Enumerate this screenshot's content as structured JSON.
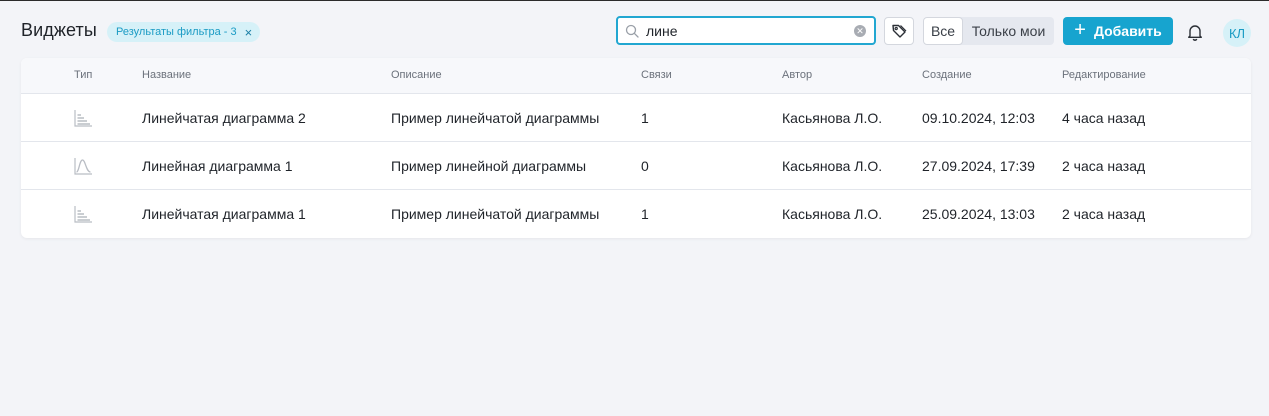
{
  "header": {
    "title": "Виджеты",
    "filter_chip": {
      "label": "Результаты фильтра - 3",
      "close": "×"
    },
    "search": {
      "value": "лине",
      "placeholder": ""
    },
    "segment": {
      "all": "Все",
      "mine": "Только мои"
    },
    "add_button": {
      "plus": "+",
      "label": "Добавить"
    },
    "avatar": "КЛ"
  },
  "columns": {
    "type": "Тип",
    "name": "Название",
    "description": "Описание",
    "links": "Связи",
    "author": "Автор",
    "created": "Создание",
    "edited": "Редактирование"
  },
  "rows": [
    {
      "icon": "bar-chart-icon",
      "name": "Линейчатая диаграмма 2",
      "description": "Пример линейчатой диаграммы",
      "links": "1",
      "author": "Касьянова Л.О.",
      "created": "09.10.2024, 12:03",
      "edited": "4 часа назад"
    },
    {
      "icon": "line-chart-icon",
      "name": "Линейная диаграмма 1",
      "description": "Пример линейной диаграммы",
      "links": "0",
      "author": "Касьянова Л.О.",
      "created": "27.09.2024, 17:39",
      "edited": "2 часа назад"
    },
    {
      "icon": "bar-chart-icon",
      "name": "Линейчатая диаграмма 1",
      "description": "Пример линейчатой диаграммы",
      "links": "1",
      "author": "Касьянова Л.О.",
      "created": "25.09.2024, 13:03",
      "edited": "2 часа назад"
    }
  ],
  "colors": {
    "accent": "#17a4cf",
    "chip_bg": "#d6f1f8",
    "page_bg": "#f3f4f8"
  }
}
